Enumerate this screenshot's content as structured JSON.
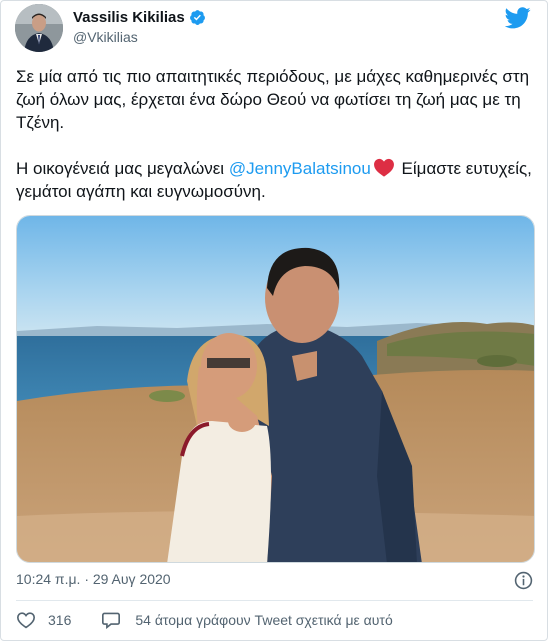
{
  "header": {
    "display_name": "Vassilis Kikilias",
    "handle": "@Vkikilias",
    "avatar": "profile-photo",
    "verified_icon": "verified-badge-icon",
    "logo_icon": "twitter-bird-icon"
  },
  "tweet": {
    "paragraph1": "Σε μία από τις πιο απαιτητικές περιόδους, με μάχες καθημερινές στη ζωή όλων μας, έρχεται ένα δώρο Θεού να φωτίσει τη ζωή μας με τη Τζένη.",
    "paragraph2_before": "Η οικογένειά μας μεγαλώνει ",
    "mention": "@JennyBalatsinou",
    "paragraph2_after": " Είμαστε ευτυχείς, γεμάτοι αγάπη και ευγνωμοσύνη.",
    "emoji": "red-heart-emoji",
    "image": "couple-by-the-sea-photo"
  },
  "meta": {
    "timestamp": "10:24 π.μ. · 29 Αυγ 2020",
    "info_icon": "info-icon"
  },
  "actions": {
    "like_icon": "heart-outline-icon",
    "like_count": "316",
    "comment_icon": "speech-bubble-icon",
    "talking_about": "54 άτομα γράφουν Tweet σχετικά με αυτό"
  },
  "colors": {
    "link": "#1d9bf0",
    "text": "#0f1419",
    "secondary": "#536471",
    "heart": "#e0245e"
  }
}
